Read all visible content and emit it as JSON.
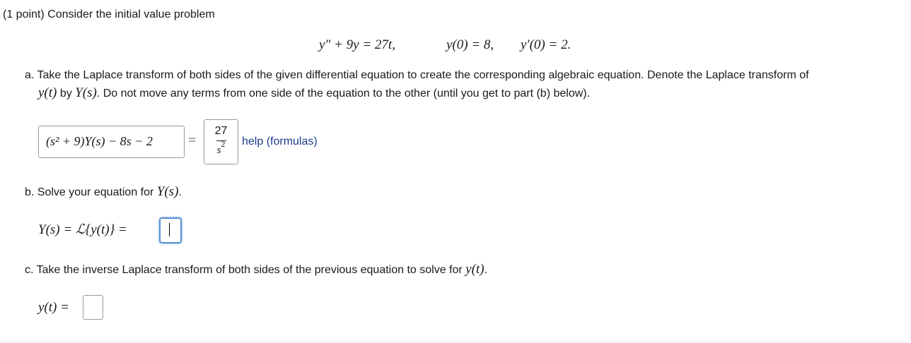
{
  "header": {
    "text": "(1 point) Consider the initial value problem"
  },
  "problem": {
    "ode_lhs": "y″ + 9y = 27t,",
    "ic1": "y(0) = 8,",
    "ic2": "y′(0) = 2."
  },
  "part_a": {
    "line1": "a. Take the Laplace transform of both sides of the given differential equation to create the corresponding algebraic equation. Denote the Laplace transform of",
    "line2_math1": "y(t)",
    "line2_by": " by ",
    "line2_math2": "Y(s)",
    "line2_rest": ". Do not move any terms from one side of the equation to the other (until you get to part (b) below).",
    "lhs_answer": "(s² + 9)Y(s) − 8s − 2",
    "equals": "=",
    "rhs_numerator": "27",
    "rhs_denominator": "s",
    "rhs_exponent": "2",
    "help_link": "help (formulas)"
  },
  "part_b": {
    "prompt": "b. Solve your equation for ",
    "prompt_math": "Y(s)",
    "prompt_end": ".",
    "label": "Y(s) = ℒ{y(t)} =",
    "answer_value": ""
  },
  "part_c": {
    "prompt": "c. Take the inverse Laplace transform of both sides of the previous equation to solve for ",
    "prompt_math": "y(t)",
    "prompt_end": ".",
    "label": "y(t) =",
    "answer_value": ""
  }
}
